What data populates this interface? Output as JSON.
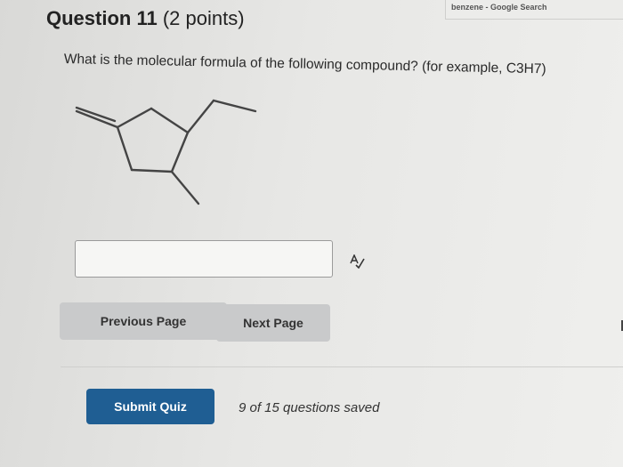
{
  "browser": {
    "tab_title": "benzene - Google Search"
  },
  "question": {
    "title_number": "Question 11",
    "points": "(2 points)",
    "text": "What is the molecular formula of the following compound? (for example, C3H7)"
  },
  "answer": {
    "value": "",
    "placeholder": ""
  },
  "navigation": {
    "previous_label": "Previous Page",
    "next_label": "Next Page"
  },
  "footer": {
    "submit_label": "Submit Quiz",
    "saved_status": "9 of 15 questions saved"
  },
  "icons": {
    "spell_check": "spell-check-icon",
    "molecule": "skeletal-structure"
  },
  "colors": {
    "submit_bg": "#1f5e93",
    "nav_button_bg": "#c9cacb"
  }
}
